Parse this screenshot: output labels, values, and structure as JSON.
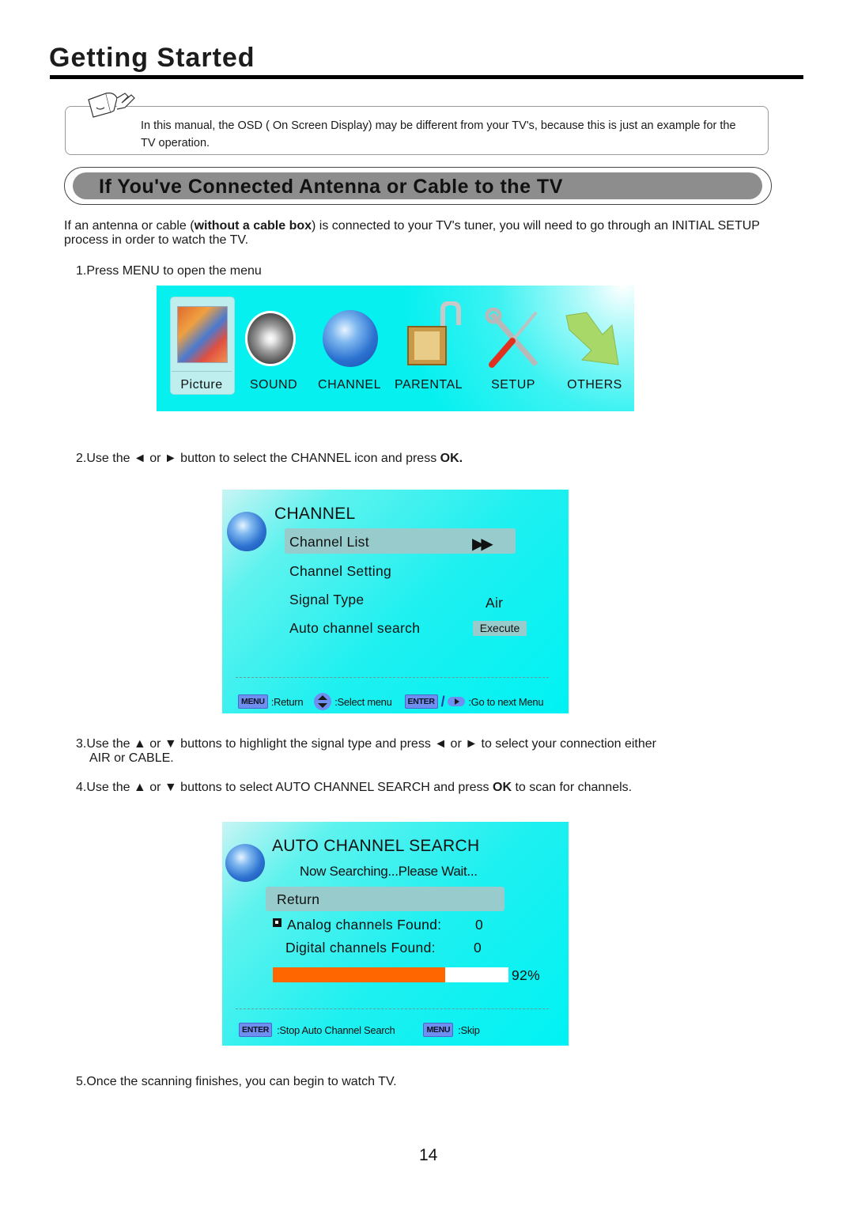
{
  "page": {
    "title": "Getting Started",
    "page_number": "14"
  },
  "note": {
    "icon": "pointing-hand-icon",
    "text": "In this manual, the OSD ( On Screen Display) may be different from your TV's, because this is just an example for the TV operation."
  },
  "section": {
    "heading": "If You've Connected Antenna or Cable to the TV"
  },
  "intro": {
    "before": "If an antenna or cable (",
    "bold": "without a cable box",
    "after": ") is connected to your TV's tuner, you will need to go through an INITIAL SETUP process in order to watch the TV."
  },
  "steps": {
    "s1": "1.Press MENU to open the menu",
    "s2_before": "2.Use the ◄ or ► button to select the CHANNEL icon and press ",
    "s2_bold": "OK.",
    "s3_line1": "3.Use the ▲ or ▼ buttons to highlight the signal type and press ◄ or ► to select your connection either",
    "s3_line2": "AIR or CABLE.",
    "s4_before": "4.Use the ▲ or ▼ buttons to select AUTO CHANNEL SEARCH and press ",
    "s4_bold": "OK",
    "s4_after": " to scan for channels.",
    "s5": "5.Once the scanning finishes, you can begin to watch TV."
  },
  "main_menu": {
    "selected": "Picture",
    "items": [
      {
        "label": "Picture",
        "icon": "picture-icon"
      },
      {
        "label": "SOUND",
        "icon": "speaker-icon"
      },
      {
        "label": "CHANNEL",
        "icon": "globe-icon"
      },
      {
        "label": "PARENTAL",
        "icon": "padlock-icon"
      },
      {
        "label": "SETUP",
        "icon": "wrench-screwdriver-icon"
      },
      {
        "label": "OTHERS",
        "icon": "arrow-icon"
      }
    ]
  },
  "channel_menu": {
    "title": "CHANNEL",
    "rows": [
      {
        "label": "Channel List",
        "value": "▶▶"
      },
      {
        "label": "Channel Setting",
        "value": ""
      },
      {
        "label": "Signal Type",
        "value": "Air"
      },
      {
        "label": "Auto channel search",
        "value": "Execute"
      }
    ],
    "hints": {
      "menu_key": "MENU",
      "menu_text": ":Return",
      "select_text": ":Select menu",
      "enter_key": "ENTER",
      "slash": "/",
      "enter_text": ":Go to next Menu"
    }
  },
  "auto_search": {
    "title": "AUTO CHANNEL SEARCH",
    "status": "Now Searching...Please Wait...",
    "return_label": "Return",
    "analog_label": "Analog channels Found:",
    "analog_count": "0",
    "digital_label": "Digital channels Found:",
    "digital_count": "0",
    "progress_percent": 92,
    "progress_label": "92%",
    "progress_color": "#ff6600",
    "hints": {
      "enter_key": "ENTER",
      "enter_text": ":Stop Auto Channel Search",
      "menu_key": "MENU",
      "menu_text": ":Skip"
    }
  }
}
